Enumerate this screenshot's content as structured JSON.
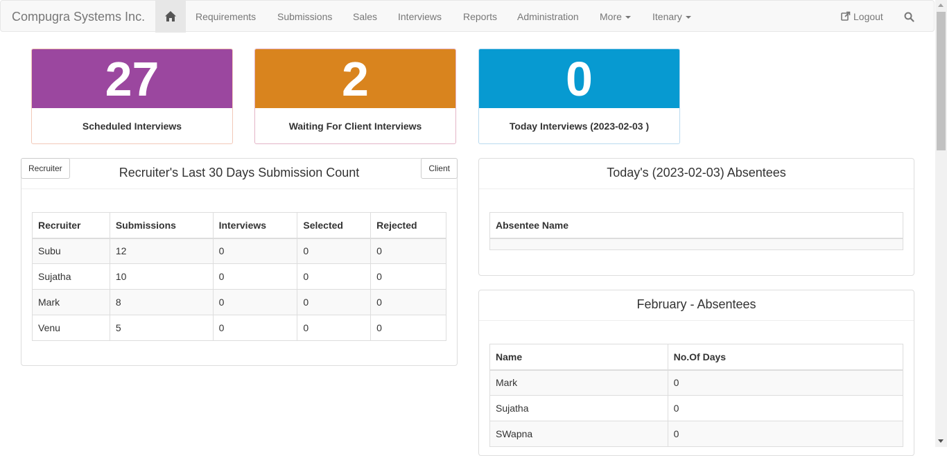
{
  "navbar": {
    "brand": "Compugra Systems Inc.",
    "links": {
      "requirements": "Requirements",
      "submissions": "Submissions",
      "sales": "Sales",
      "interviews": "Interviews",
      "reports": "Reports",
      "administration": "Administration",
      "more": "More",
      "itenary": "Itenary",
      "logout": "Logout"
    },
    "icons": {
      "home": "home-icon",
      "logout": "logout-icon",
      "search": "search-icon"
    }
  },
  "stats": {
    "scheduled": {
      "value": "27",
      "label": "Scheduled Interviews",
      "color": "#9b479f"
    },
    "waiting": {
      "value": "2",
      "label": "Waiting For Client Interviews",
      "color": "#d9841e"
    },
    "today": {
      "value": "0",
      "label": "Today Interviews (2023-02-03 )",
      "color": "#079ad1"
    }
  },
  "submissions_panel": {
    "title": "Recruiter's Last 30 Days Submission Count",
    "recruiter_button": "Recruiter",
    "client_button": "Client",
    "columns": [
      "Recruiter",
      "Submissions",
      "Interviews",
      "Selected",
      "Rejected"
    ],
    "rows": [
      [
        "Subu",
        "12",
        "0",
        "0",
        "0"
      ],
      [
        "Sujatha",
        "10",
        "0",
        "0",
        "0"
      ],
      [
        "Mark",
        "8",
        "0",
        "0",
        "0"
      ],
      [
        "Venu",
        "5",
        "0",
        "0",
        "0"
      ]
    ]
  },
  "absentees_today": {
    "title": "Today's (2023-02-03) Absentees",
    "column": "Absentee Name"
  },
  "absentees_month": {
    "title": "February - Absentees",
    "columns": [
      "Name",
      "No.Of Days"
    ],
    "rows": [
      [
        "Mark",
        "0"
      ],
      [
        "Sujatha",
        "0"
      ],
      [
        "SWapna",
        "0"
      ]
    ]
  }
}
